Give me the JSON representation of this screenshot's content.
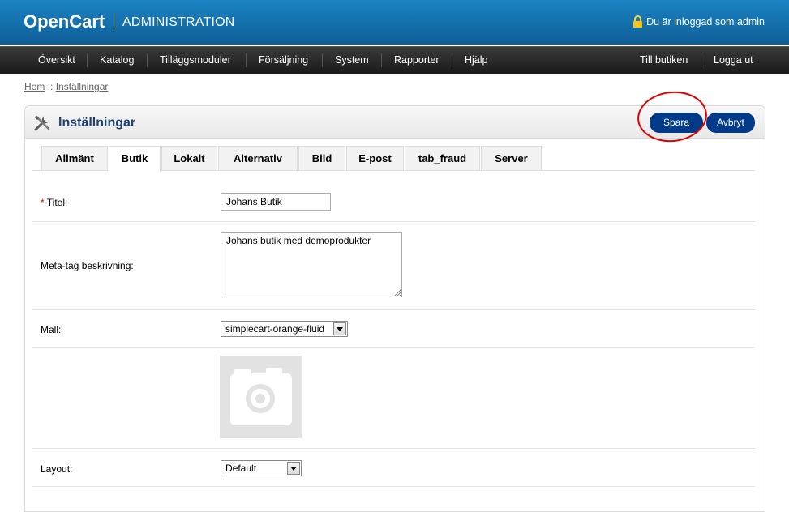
{
  "header": {
    "logo": "OpenCart",
    "title": "ADMINISTRATION",
    "login_text": "Du är inloggad som admin"
  },
  "menu": {
    "left": [
      "Översikt",
      "Katalog",
      "Tilläggsmoduler",
      "Försäljning",
      "System",
      "Rapporter",
      "Hjälp"
    ],
    "right": [
      "Till butiken",
      "Logga ut"
    ]
  },
  "breadcrumb": {
    "home": "Hem",
    "separator": " :: ",
    "current": "Inställningar"
  },
  "page": {
    "title": "Inställningar",
    "save_label": "Spara",
    "cancel_label": "Avbryt"
  },
  "tabs": [
    "Allmänt",
    "Butik",
    "Lokalt",
    "Alternativ",
    "Bild",
    "E-post",
    "tab_fraud",
    "Server"
  ],
  "active_tab": "Butik",
  "form": {
    "title_label": "Titel:",
    "title_required": "*",
    "title_value": "Johans Butik",
    "meta_label": "Meta-tag beskrivning:",
    "meta_value": "Johans butik med demoprodukter",
    "template_label": "Mall:",
    "template_value": "simplecart-orange-fluid",
    "layout_label": "Layout:",
    "layout_value": "Default"
  },
  "colors": {
    "header_blue": "#1678b8",
    "button_blue": "#003a88",
    "title_blue": "#1d3f72",
    "highlight_red": "#e00000"
  },
  "icons": {
    "lock": "lock-icon",
    "settings": "tools-icon",
    "image_placeholder": "camera-icon"
  }
}
